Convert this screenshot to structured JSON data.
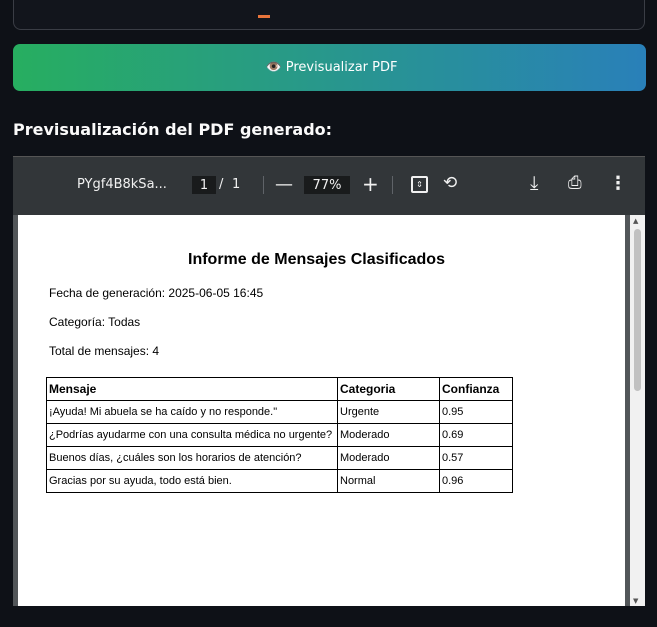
{
  "preview_button": {
    "icon": "eye-icon",
    "emoji": "👁️",
    "label": "Previsualizar PDF"
  },
  "heading": "Previsualización del PDF generado:",
  "viewer": {
    "filename": "PYgf4B8kSa...",
    "page_current": "1",
    "page_sep": "/",
    "page_total": "1",
    "zoom": "77%"
  },
  "pdf": {
    "title": "Informe de Mensajes Clasificados",
    "date_line": "Fecha de generación: 2025-06-05 16:45",
    "category_line": "Categoría: Todas",
    "total_line": "Total de mensajes: 4",
    "columns": [
      "Mensaje",
      "Categoria",
      "Confianza"
    ],
    "rows": [
      [
        "¡Ayuda! Mi abuela se ha caído y no responde.\"",
        "Urgente",
        "0.95"
      ],
      [
        "¿Podrías ayudarme con una consulta médica no urgente?",
        "Moderado",
        "0.69"
      ],
      [
        "Buenos días, ¿cuáles son los horarios de atención?",
        "Moderado",
        "0.57"
      ],
      [
        "Gracias por su ayuda, todo está bien.",
        "Normal",
        "0.96"
      ]
    ]
  }
}
